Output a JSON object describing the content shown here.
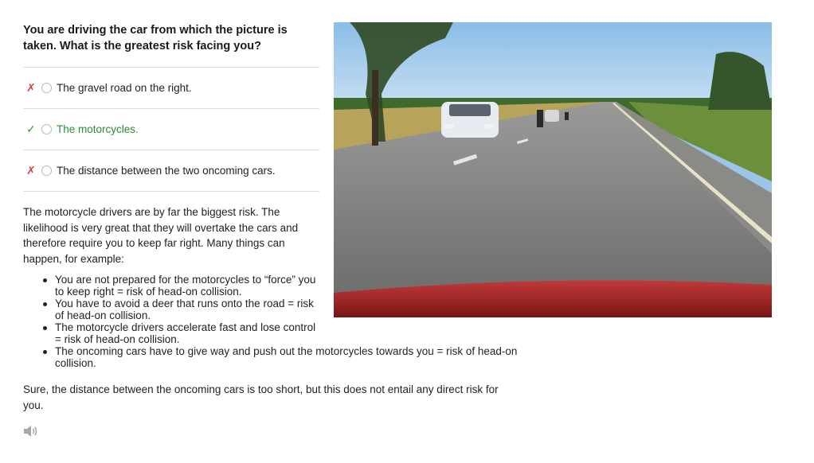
{
  "question": "You are driving the car from which the picture is taken. What is the greatest risk facing you?",
  "options": [
    {
      "mark": "✗",
      "status": "wrong",
      "label": "The gravel road on the right."
    },
    {
      "mark": "✓",
      "status": "correct",
      "label": "The motorcycles."
    },
    {
      "mark": "✗",
      "status": "wrong",
      "label": "The distance between the two oncoming cars."
    }
  ],
  "explanation": "The motorcycle drivers are by far the biggest risk. The likelihood is very great that they will overtake the cars and therefore require you to keep far right. Many things can happen, for example:",
  "bullets": [
    "You are not prepared for the motorcycles to “force” you to keep right = risk of head-on collision.",
    "You have to avoid a deer that runs onto the road = risk of head-on collision.",
    "The motorcycle drivers accelerate fast and lose control = risk of head-on collision.",
    "The oncoming cars have to give way and push out the motorcycles towards you = risk of head-on collision."
  ],
  "conclusion": "Sure, the distance between the oncoming cars is too short, but this does not entail any direct risk for you.",
  "icons": {
    "audio": "speaker-icon",
    "wrong": "cross-icon",
    "correct": "check-icon"
  },
  "colors": {
    "wrong": "#e0393e",
    "correct": "#2e8b2e",
    "divider": "#dcdcdc"
  }
}
